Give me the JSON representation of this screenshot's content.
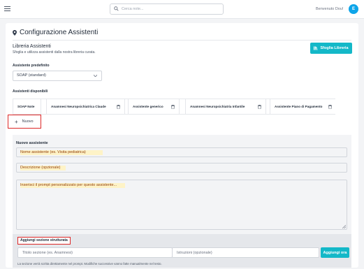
{
  "topbar": {
    "search_placeholder": "Cerca note...",
    "welcome": "Benvenuto Dou!",
    "avatar_letter": "E"
  },
  "page": {
    "title": "Configurazione Assistenti",
    "title_icon": "map-pin-icon"
  },
  "library": {
    "title": "Libreria Assistenti",
    "subtitle": "Sfoglia e utilizza assistenti dalla nostra libreria curata.",
    "browse_button": "Sfoglia Libreria",
    "browse_icon": "library-icon"
  },
  "default_assistant": {
    "label": "Assistente predefinito",
    "selected": "SOAP (standard)"
  },
  "available": {
    "label": "Assistenti disponibili",
    "chips": [
      {
        "label": "SOAP Note",
        "deletable": false
      },
      {
        "label": "Anamnesi Neuropsichiatrica Claude",
        "deletable": true
      },
      {
        "label": "Assistente generico",
        "deletable": true
      },
      {
        "label": "Anamnesi Neuropsichiatria Infantile",
        "deletable": true
      },
      {
        "label": "Assistente Piano di Pagamento",
        "deletable": true
      }
    ],
    "new_button": "Nuovo"
  },
  "new_assistant": {
    "title": "Nuovo assistente",
    "name_placeholder": "Nome assistente (es. Visita pediatrica)",
    "description_placeholder": "Descrizione (opzionale)",
    "prompt_placeholder": "Inserisci il prompt personalizzato per questo assistente...",
    "structured_section_label": "Aggiungi sezione strutturata",
    "section_title_placeholder": "Titolo sezione (es. Anamnesi)",
    "instructions_placeholder": "Istruzioni (opzionale)",
    "add_now_button": "Aggiungi ora",
    "note": "La sezione verrà scritta direttamente nel prompt. Modifiche successive vanno fatte manualmente nel testo."
  },
  "colors": {
    "accent": "#14b8c8",
    "highlight_border": "#dc2626",
    "avatar": "#0ea5e9"
  }
}
